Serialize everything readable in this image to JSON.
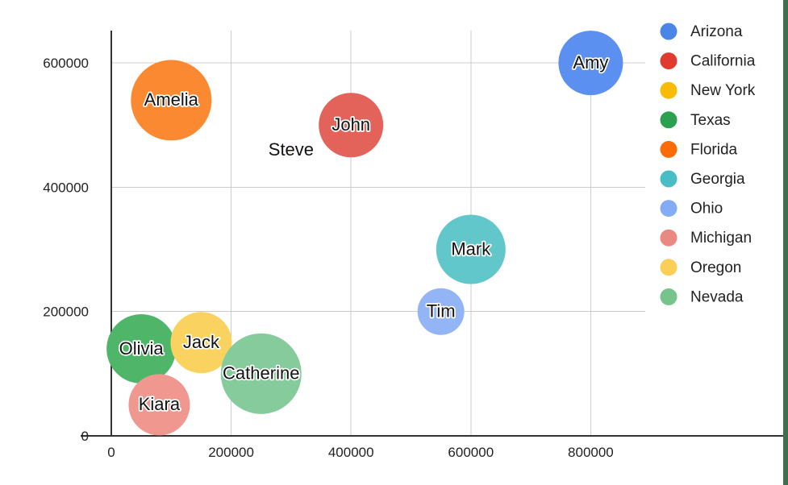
{
  "chart_data": {
    "type": "scatter",
    "title": "",
    "xlabel": "",
    "ylabel": "",
    "xlim": [
      -25000,
      880000
    ],
    "ylim": [
      0,
      640000
    ],
    "xticks": [
      "0",
      "200000",
      "400000",
      "600000",
      "800000"
    ],
    "xtick_values": [
      0,
      200000,
      400000,
      600000,
      800000
    ],
    "yticks": [
      "0",
      "200000",
      "400000",
      "600000"
    ],
    "ytick_values": [
      0,
      200000,
      400000,
      600000
    ],
    "grid": true,
    "legend_position": "right",
    "legend": [
      {
        "label": "Arizona",
        "color": "#4a86e8"
      },
      {
        "label": "California",
        "color": "#e03b2f"
      },
      {
        "label": "New York",
        "color": "#f8bb07"
      },
      {
        "label": "Texas",
        "color": "#2ba14f"
      },
      {
        "label": "Florida",
        "color": "#fb6c07"
      },
      {
        "label": "Georgia",
        "color": "#48bdc5"
      },
      {
        "label": "Ohio",
        "color": "#84abf5"
      },
      {
        "label": "Michigan",
        "color": "#ea8981"
      },
      {
        "label": "Oregon",
        "color": "#fbcf57"
      },
      {
        "label": "Nevada",
        "color": "#76c48c"
      }
    ],
    "points": [
      {
        "label": "Amy",
        "group": "Arizona",
        "x": 800000,
        "y": 600000,
        "size": 40,
        "color": "#5b8ff0"
      },
      {
        "label": "Amelia",
        "group": "Florida",
        "x": 100000,
        "y": 540000,
        "size": 50,
        "color": "#fb8932"
      },
      {
        "label": "John",
        "group": "California",
        "x": 400000,
        "y": 500000,
        "size": 40,
        "color": "#e36259"
      },
      {
        "label": "Steve",
        "group": "New York",
        "x": 300000,
        "y": 460000,
        "size": 6,
        "color": "#f8bb07"
      },
      {
        "label": "Mark",
        "group": "Georgia",
        "x": 600000,
        "y": 300000,
        "size": 43,
        "color": "#61c7cb"
      },
      {
        "label": "Tim",
        "group": "Ohio",
        "x": 550000,
        "y": 200000,
        "size": 29,
        "color": "#93b5f5"
      },
      {
        "label": "Olivia",
        "group": "Texas",
        "x": 50000,
        "y": 140000,
        "size": 43,
        "color": "#4fb569"
      },
      {
        "label": "Jack",
        "group": "Oregon",
        "x": 150000,
        "y": 150000,
        "size": 38,
        "color": "#f9d260"
      },
      {
        "label": "Catherine",
        "group": "Nevada",
        "x": 250000,
        "y": 100000,
        "size": 50,
        "color": "#85cb9b"
      },
      {
        "label": "Kiara",
        "group": "Michigan",
        "x": 80000,
        "y": 50000,
        "size": 38,
        "color": "#f09890"
      }
    ]
  },
  "style": {
    "background": "#ffffff",
    "grid_color": "#cccccc",
    "axis_color": "#333333",
    "edge_band_color": "#3f6f4e"
  }
}
